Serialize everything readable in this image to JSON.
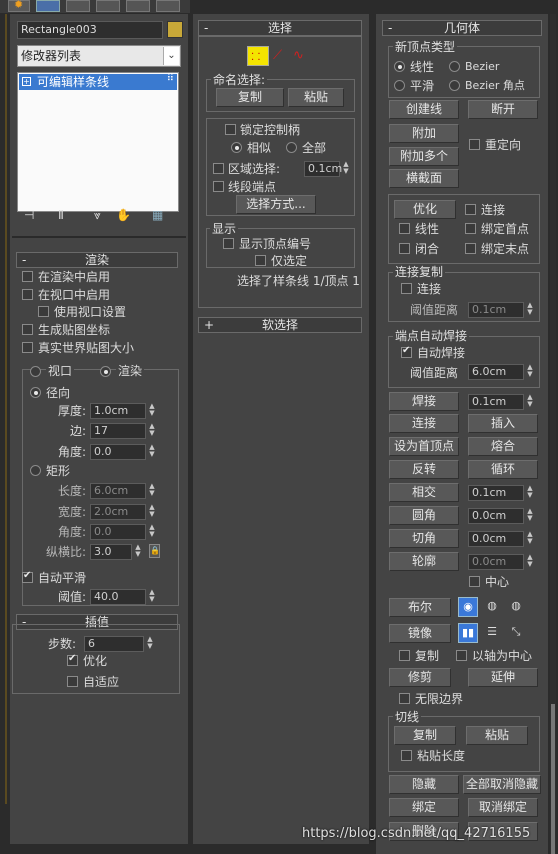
{
  "top": {
    "object_name": "Rectangle003",
    "modifier_list": "修改器列表",
    "stack_item": "可编辑样条线"
  },
  "render": {
    "header": "渲染",
    "enable_in_render": "在渲染中启用",
    "enable_in_viewport": "在视口中启用",
    "use_viewport_settings": "使用视口设置",
    "gen_mapping": "生成贴图坐标",
    "real_world_map": "真实世界贴图大小",
    "viewport_radio": "视口",
    "render_radio": "渲染",
    "radial": "径向",
    "thickness_label": "厚度:",
    "thickness": "1.0cm",
    "sides_label": "边:",
    "sides": "17",
    "angle_label": "角度:",
    "angle": "0.0",
    "rectangular": "矩形",
    "length_label": "长度:",
    "length": "6.0cm",
    "width_label": "宽度:",
    "width": "2.0cm",
    "angle2_label": "角度:",
    "angle2": "0.0",
    "aspect_label": "纵横比:",
    "aspect": "3.0",
    "auto_smooth": "自动平滑",
    "threshold_label": "阈值:",
    "threshold": "40.0"
  },
  "interp": {
    "header": "插值",
    "steps_label": "步数:",
    "steps": "6",
    "optimize": "优化",
    "adaptive": "自适应"
  },
  "selection": {
    "header": "选择",
    "named_sel": "命名选择:",
    "copy": "复制",
    "paste": "粘贴",
    "lock_handles": "锁定控制柄",
    "alike": "相似",
    "all": "全部",
    "area_sel": "区域选择:",
    "area_val": "0.1cm",
    "seg_end": "线段端点",
    "sel_by": "选择方式...",
    "display": "显示",
    "show_vertex_num": "显示顶点编号",
    "only_selected": "仅选定",
    "status": "选择了样条线 1/顶点 1"
  },
  "soft_sel": {
    "header": "软选择"
  },
  "geometry": {
    "header": "几何体",
    "new_vertex_type": "新顶点类型",
    "linear": "线性",
    "bezier": "Bezier",
    "smooth": "平滑",
    "bezier_corner": "Bezier 角点",
    "create_line": "创建线",
    "break": "断开",
    "attach": "附加",
    "reorient": "重定向",
    "attach_mult": "附加多个",
    "cross_section": "横截面",
    "refine": "优化",
    "connect": "连接",
    "linear2": "线性",
    "bind_first": "绑定首点",
    "closed": "闭合",
    "bind_last": "绑定末点",
    "connect_copy": "连接复制",
    "connect2": "连接",
    "thresh_dist": "阈值距离",
    "thresh_val": "0.1cm",
    "end_weld": "端点自动焊接",
    "auto_weld": "自动焊接",
    "thresh_dist2": "阈值距离",
    "thresh_val2": "6.0cm",
    "weld": "焊接",
    "weld_val": "0.1cm",
    "connect3": "连接",
    "insert": "插入",
    "make_first": "设为首顶点",
    "fuse": "熔合",
    "reverse": "反转",
    "cycle": "循环",
    "crossinsert": "相交",
    "cross_val": "0.1cm",
    "fillet": "圆角",
    "fillet_val": "0.0cm",
    "chamfer": "切角",
    "chamfer_val": "0.0cm",
    "outline": "轮廓",
    "outline_val": "0.0cm",
    "center": "中心",
    "boolean": "布尔",
    "mirror": "镜像",
    "copy": "复制",
    "about_pivot": "以轴为中心",
    "trim": "修剪",
    "extend": "延伸",
    "infinite": "无限边界",
    "tangent": "切线",
    "t_copy": "复制",
    "t_paste": "粘贴",
    "paste_length": "粘贴长度",
    "hide": "隐藏",
    "unhide_all": "全部取消隐藏",
    "bind": "绑定",
    "unbind": "取消绑定",
    "delete": "删除"
  },
  "watermark": "https://blog.csdn.net/qq_42716155"
}
